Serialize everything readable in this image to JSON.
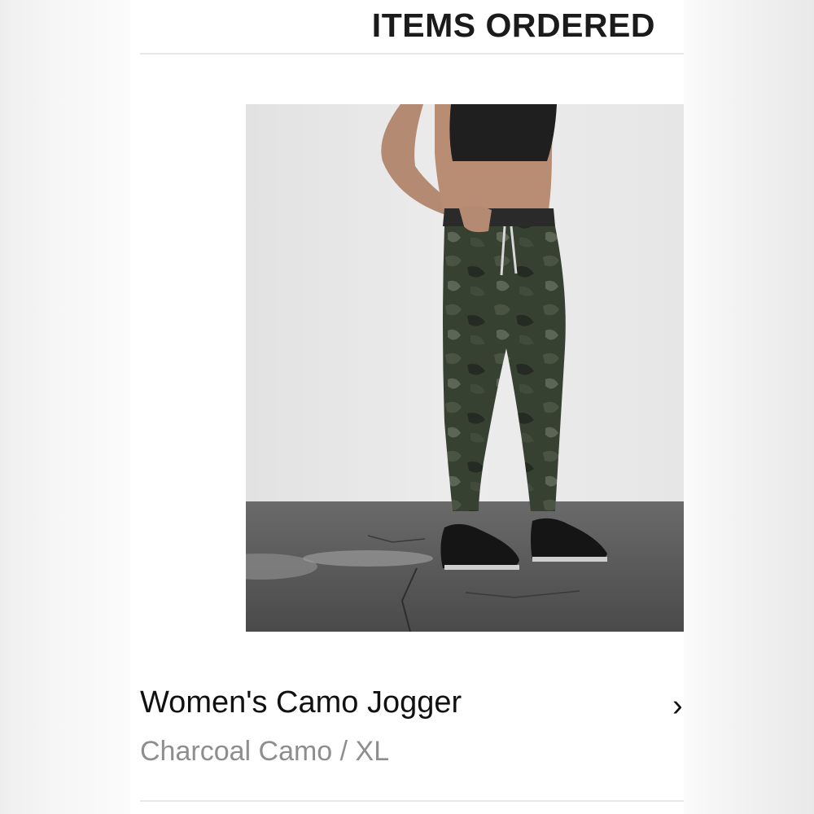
{
  "section": {
    "title": "ITEMS ORDERED"
  },
  "item": {
    "name": "Women's Camo Jogger",
    "variant": "Charcoal Camo / XL",
    "chevron": "›"
  },
  "icons": {
    "chevron": "chevron-right-icon"
  }
}
